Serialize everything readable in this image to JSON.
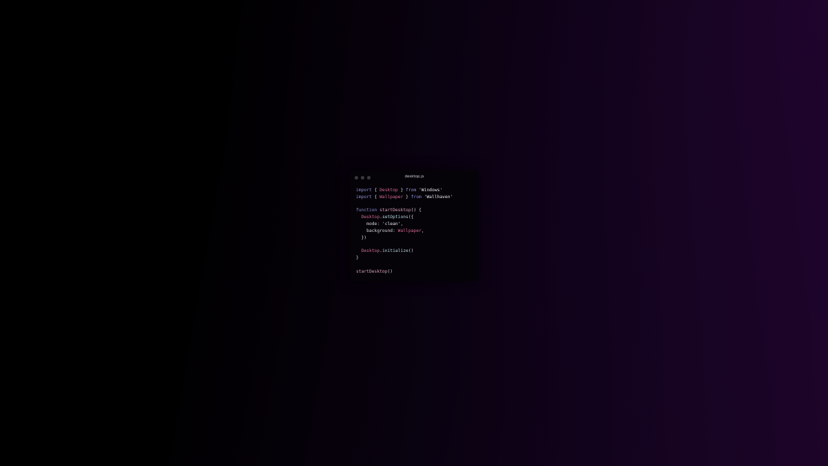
{
  "window": {
    "title": "desktop.js"
  },
  "code": {
    "lines": [
      [
        {
          "t": "import",
          "c": "kw"
        },
        {
          "t": " { ",
          "c": "punc"
        },
        {
          "t": "Desktop",
          "c": "cls"
        },
        {
          "t": " } ",
          "c": "punc"
        },
        {
          "t": "from",
          "c": "kw"
        },
        {
          "t": " 'Windows'",
          "c": "str"
        }
      ],
      [
        {
          "t": "import",
          "c": "kw"
        },
        {
          "t": " { ",
          "c": "punc"
        },
        {
          "t": "Wallpaper",
          "c": "cls"
        },
        {
          "t": " } ",
          "c": "punc"
        },
        {
          "t": "from",
          "c": "kw"
        },
        {
          "t": " 'Wallhaven'",
          "c": "str"
        }
      ],
      [],
      [
        {
          "t": "function",
          "c": "kw"
        },
        {
          "t": " ",
          "c": "punc"
        },
        {
          "t": "startDesktop",
          "c": "fn"
        },
        {
          "t": "() {",
          "c": "punc"
        }
      ],
      [
        {
          "t": "  ",
          "c": "punc"
        },
        {
          "t": "Desktop",
          "c": "cls"
        },
        {
          "t": ".",
          "c": "punc"
        },
        {
          "t": "setOptions",
          "c": "mth"
        },
        {
          "t": "({",
          "c": "punc"
        }
      ],
      [
        {
          "t": "    mode: ",
          "c": "prop"
        },
        {
          "t": "'clean'",
          "c": "str"
        },
        {
          "t": ",",
          "c": "punc"
        }
      ],
      [
        {
          "t": "    background: ",
          "c": "prop"
        },
        {
          "t": "Wallpaper",
          "c": "cls"
        },
        {
          "t": ",",
          "c": "punc"
        }
      ],
      [
        {
          "t": "  })",
          "c": "punc"
        }
      ],
      [],
      [
        {
          "t": "  ",
          "c": "punc"
        },
        {
          "t": "Desktop",
          "c": "cls"
        },
        {
          "t": ".",
          "c": "punc"
        },
        {
          "t": "initialize",
          "c": "mth"
        },
        {
          "t": "()",
          "c": "punc"
        }
      ],
      [
        {
          "t": "}",
          "c": "punc"
        }
      ],
      [],
      [
        {
          "t": "startDesktop",
          "c": "fn"
        },
        {
          "t": "()",
          "c": "punc"
        }
      ]
    ]
  },
  "colors": {
    "keyword": "#8e8fd6",
    "class_name": "#d46b8e",
    "string": "#e8e8ee",
    "function_name": "#d9a0b8",
    "method": "#b8d8e0",
    "wallpaper_accent": "#2a0536"
  },
  "icons": {
    "window_controls": [
      "window-close-dot-icon",
      "window-minimize-dot-icon",
      "window-maximize-dot-icon"
    ]
  }
}
